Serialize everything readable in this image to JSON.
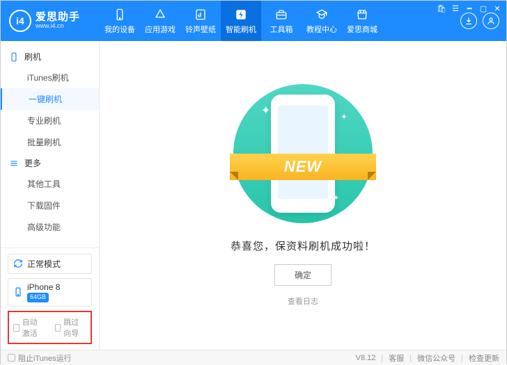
{
  "brand": {
    "name": "爱思助手",
    "url": "www.i4.cn",
    "logo_text": "i4"
  },
  "window_controls": [
    "cart-icon",
    "menu-icon",
    "minimize",
    "maximize",
    "close"
  ],
  "header_circles": [
    "download-icon",
    "user-icon"
  ],
  "nav": [
    {
      "label": "我的设备",
      "icon": "phone-icon"
    },
    {
      "label": "应用游戏",
      "icon": "apps-icon"
    },
    {
      "label": "铃声壁纸",
      "icon": "music-icon"
    },
    {
      "label": "智能刷机",
      "icon": "flash-icon",
      "active": true
    },
    {
      "label": "工具箱",
      "icon": "toolbox-icon"
    },
    {
      "label": "教程中心",
      "icon": "tutorial-icon"
    },
    {
      "label": "爱思商城",
      "icon": "store-icon"
    }
  ],
  "sidebar": {
    "sections": [
      {
        "title": "刷机",
        "icon": "device-icon",
        "items": [
          {
            "label": "iTunes刷机"
          },
          {
            "label": "一键刷机",
            "selected": true
          },
          {
            "label": "专业刷机"
          },
          {
            "label": "批量刷机"
          }
        ]
      },
      {
        "title": "更多",
        "icon": "more-icon",
        "items": [
          {
            "label": "其他工具"
          },
          {
            "label": "下载固件"
          },
          {
            "label": "高级功能"
          }
        ]
      }
    ],
    "mode": {
      "label": "正常模式"
    },
    "device": {
      "name": "iPhone 8",
      "storage": "64GB"
    },
    "checks": {
      "auto_activate": "自动激活",
      "skip_wizard": "跳过向导"
    }
  },
  "content": {
    "ribbon": "NEW",
    "success": "恭喜您，保资料刷机成功啦！",
    "ok": "确定",
    "log": "查看日志"
  },
  "footer": {
    "block_itunes": "阻止iTunes运行",
    "version": "V8.12",
    "links": [
      "客服",
      "微信公众号",
      "检查更新"
    ]
  }
}
